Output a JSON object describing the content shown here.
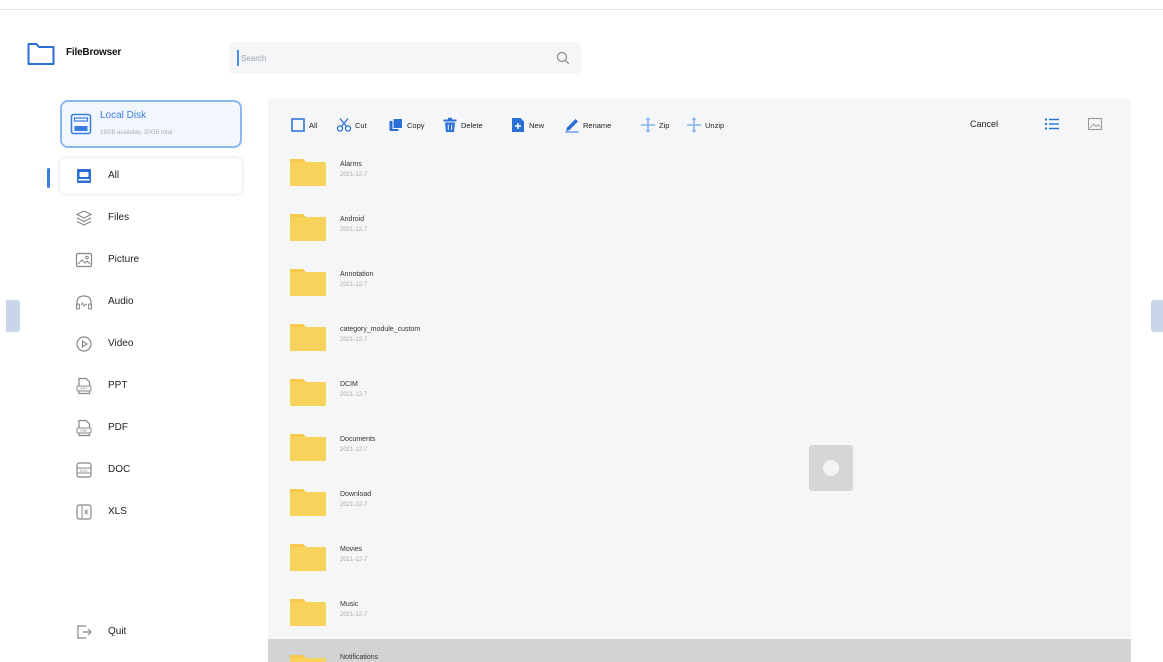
{
  "app": {
    "title": "FileBrowser"
  },
  "search": {
    "placeholder": "Search"
  },
  "disk": {
    "title": "Local Disk",
    "subtitle": "19GB available, 20GB total"
  },
  "nav": {
    "items": [
      {
        "label": "All",
        "icon": "all-icon",
        "active": true
      },
      {
        "label": "Files",
        "icon": "files-icon"
      },
      {
        "label": "Picture",
        "icon": "picture-icon"
      },
      {
        "label": "Audio",
        "icon": "audio-icon"
      },
      {
        "label": "Video",
        "icon": "video-icon"
      },
      {
        "label": "PPT",
        "icon": "ppt-icon"
      },
      {
        "label": "PDF",
        "icon": "pdf-icon"
      },
      {
        "label": "DOC",
        "icon": "doc-icon"
      },
      {
        "label": "XLS",
        "icon": "xls-icon"
      }
    ],
    "quit": "Quit"
  },
  "toolbar": {
    "all": "All",
    "cut": "Cut",
    "copy": "Copy",
    "delete": "Delete",
    "new": "New",
    "rename": "Rename",
    "zip": "Zip",
    "unzip": "Unzip",
    "cancel": "Cancel"
  },
  "files": [
    {
      "name": "Alarms",
      "date": "2021-12-7"
    },
    {
      "name": "Android",
      "date": "2021-12-7"
    },
    {
      "name": "Annotation",
      "date": "2021-12-7"
    },
    {
      "name": "category_module_custom",
      "date": "2021-12-7"
    },
    {
      "name": "DCIM",
      "date": "2021-12-7"
    },
    {
      "name": "Documents",
      "date": "2021-12-7"
    },
    {
      "name": "Download",
      "date": "2021-12-7"
    },
    {
      "name": "Movies",
      "date": "2021-12-7"
    },
    {
      "name": "Music",
      "date": "2021-12-7"
    },
    {
      "name": "Notifications",
      "date": ""
    }
  ],
  "colors": {
    "accent": "#3a7de0",
    "folder": "#f6c94a",
    "panel": "#f5f6f8",
    "selected": "#d2d3d5"
  }
}
